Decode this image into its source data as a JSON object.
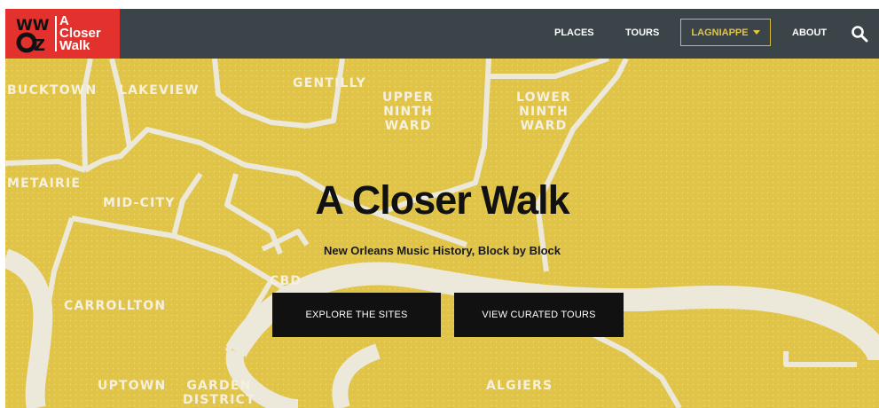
{
  "logo": {
    "station": "WWOZ",
    "brand": "A\nCloser\nWalk"
  },
  "nav": {
    "places": "PLACES",
    "tours": "TOURS",
    "lagniappe": "LAGNIAPPE",
    "about": "ABOUT"
  },
  "icons": {
    "search": "search-icon",
    "dropdown": "caret-down-icon"
  },
  "hero": {
    "title": "A Closer Walk",
    "subtitle": "New Orleans Music History, Block by Block",
    "explore_label": "EXPLORE THE SITES",
    "tours_label": "VIEW CURATED TOURS"
  },
  "neighborhoods": {
    "bucktown": "BUCKTOWN",
    "lakeview": "LAKEVIEW",
    "gentilly": "GENTILLY",
    "upper_ninth": "UPPER\nNINTH\nWARD",
    "lower_ninth": "LOWER\nNINTH\nWARD",
    "metairie": "METAIRIE",
    "mid_city": "MID-CITY",
    "cbd": "CBD",
    "carrollton": "CARROLLTON",
    "uptown": "UPTOWN",
    "garden_district": "GARDEN\nDISTRICT",
    "algiers": "ALGIERS"
  },
  "colors": {
    "header": "#3b4449",
    "logo": "#e3312d",
    "map": "#e0c44a",
    "roads": "#ece8da",
    "accent": "#e3c443",
    "button": "#111111"
  }
}
